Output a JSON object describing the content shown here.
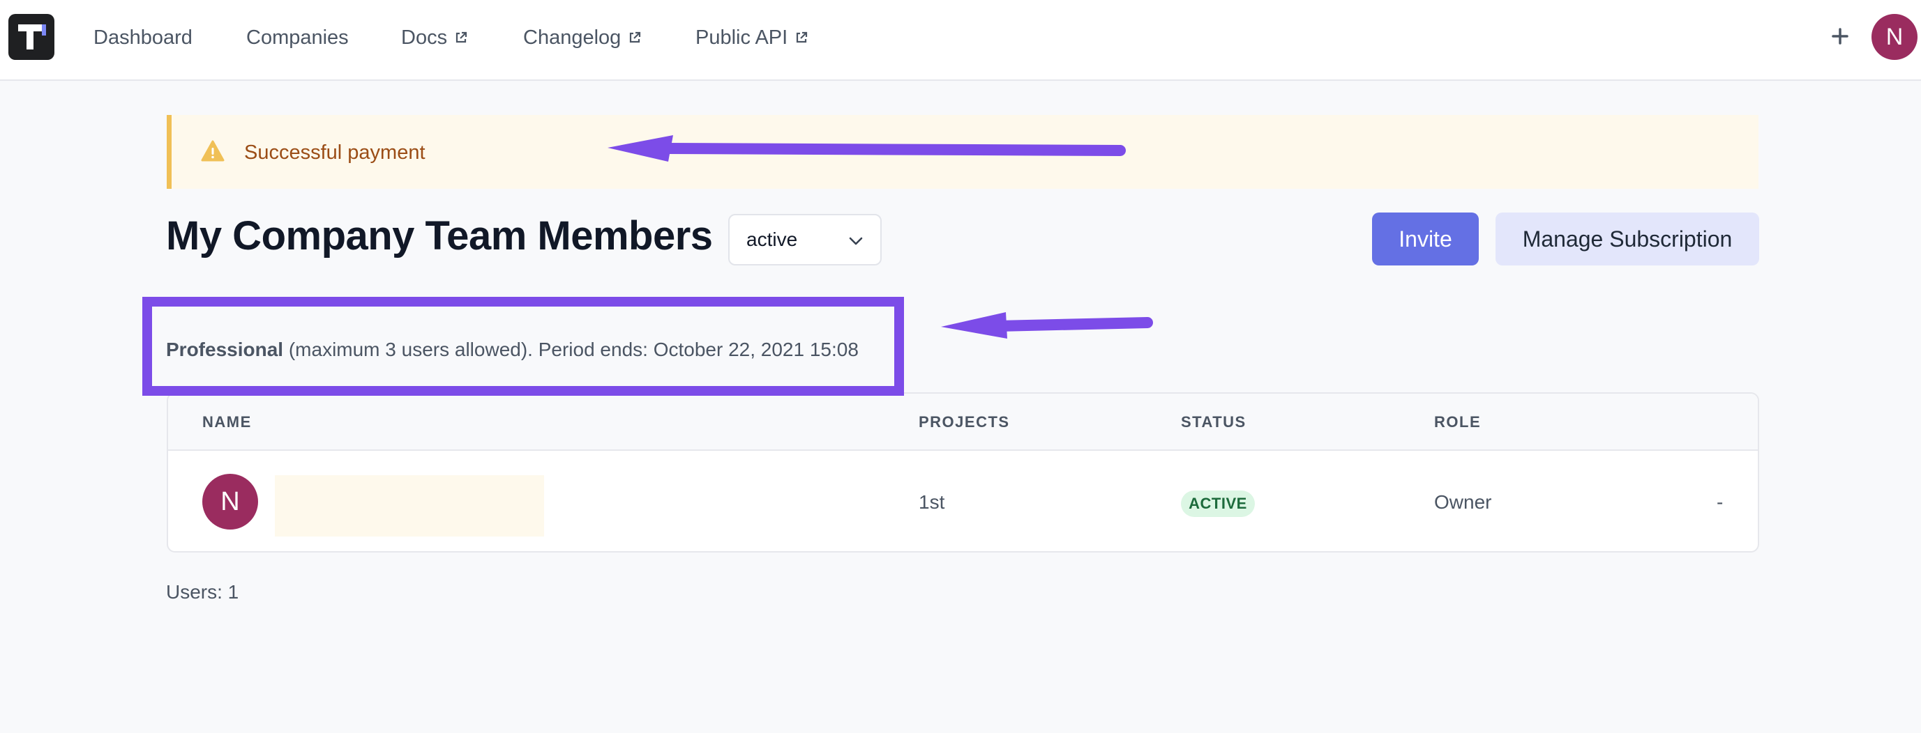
{
  "nav": {
    "links": [
      {
        "label": "Dashboard",
        "external": false
      },
      {
        "label": "Companies",
        "external": false
      },
      {
        "label": "Docs",
        "external": true
      },
      {
        "label": "Changelog",
        "external": true
      },
      {
        "label": "Public API",
        "external": true
      }
    ],
    "user_initial": "N"
  },
  "alert": {
    "message": "Successful payment",
    "icon": "warning-triangle-icon"
  },
  "header": {
    "title": "My Company Team Members",
    "status_filter": "active",
    "invite_label": "Invite",
    "manage_label": "Manage Subscription"
  },
  "plan": {
    "name": "Professional",
    "details": " (maximum 3 users allowed). Period ends: October 22, 2021 15:08"
  },
  "table": {
    "columns": [
      "NAME",
      "PROJECTS",
      "STATUS",
      "ROLE"
    ],
    "rows": [
      {
        "initial": "N",
        "name": "",
        "projects": "1st",
        "status": "ACTIVE",
        "role": "Owner",
        "action": "-"
      }
    ]
  },
  "footer": {
    "users_count": "Users: 1"
  },
  "colors": {
    "accent": "#6470e4",
    "avatar": "#9a2c5f",
    "alert_background": "#fef9ec",
    "alert_border": "#f0c056",
    "annotation": "#7c4ce8",
    "status_active": "#1d6b3c"
  }
}
